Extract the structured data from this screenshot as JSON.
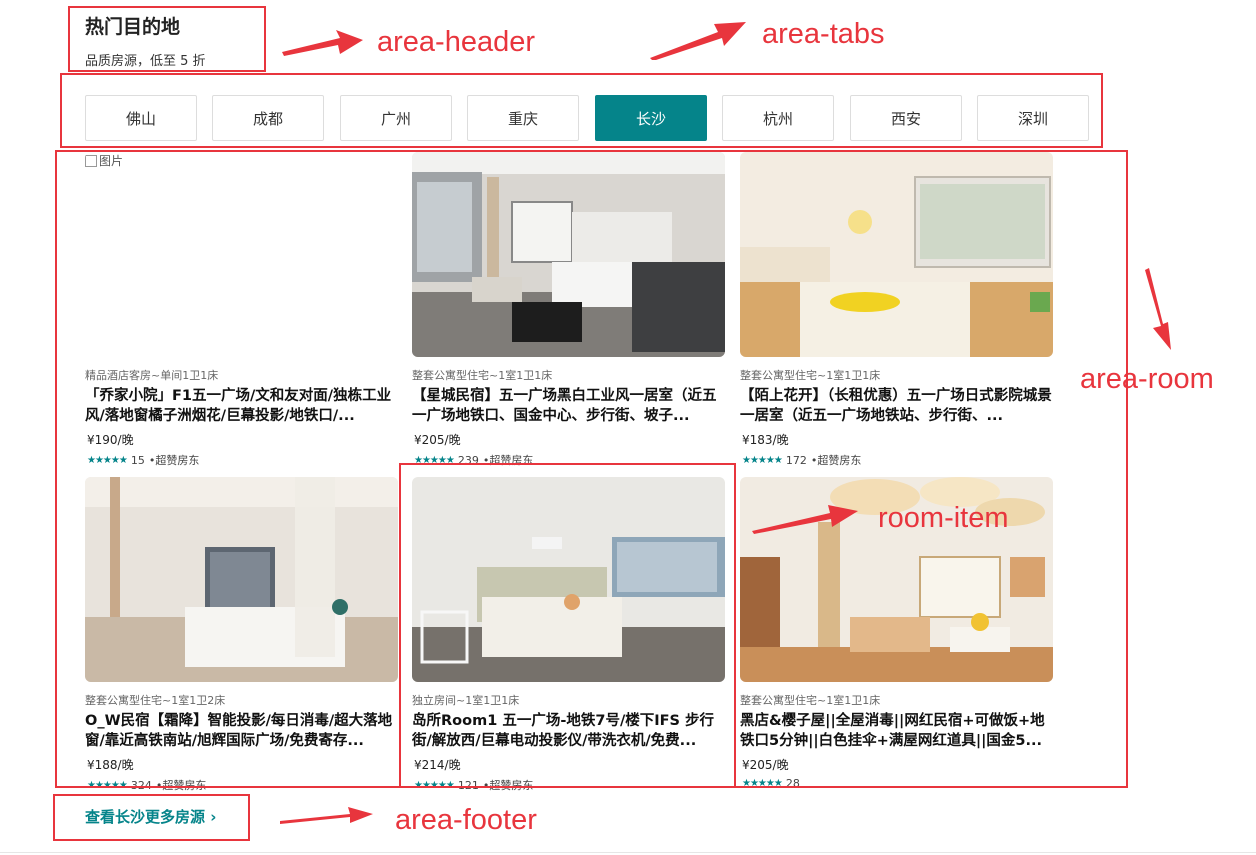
{
  "header": {
    "title": "热门目的地",
    "subtitle": "品质房源，低至 5 折"
  },
  "tabs": [
    {
      "label": "佛山"
    },
    {
      "label": "成都"
    },
    {
      "label": "广州"
    },
    {
      "label": "重庆"
    },
    {
      "label": "长沙",
      "active": true
    },
    {
      "label": "杭州"
    },
    {
      "label": "西安"
    },
    {
      "label": "深圳"
    }
  ],
  "rooms": [
    {
      "broken_alt": "图片",
      "type": "精品酒店客房~单间1卫1床",
      "title": "「乔家小院」F1五一广场/文和友对面/独栋工业风/落地窗橘子洲烟花/巨幕投影/地铁口/...",
      "price": "¥190/晚",
      "stars": "★★★★★",
      "reviews": "15",
      "badge": "•超赞房东"
    },
    {
      "type": "整套公寓型住宅~1室1卫1床",
      "title": "【星城民宿】五一广场黑白工业风一居室（近五一广场地铁口、国金中心、步行街、坡子...",
      "price": "¥205/晚",
      "stars": "★★★★★",
      "reviews": "239",
      "badge": "•超赞房东"
    },
    {
      "type": "整套公寓型住宅~1室1卫1床",
      "title": "【陌上花开】（长租优惠）五一广场日式影院城景一居室（近五一广场地铁站、步行街、...",
      "price": "¥183/晚",
      "stars": "★★★★★",
      "reviews": "172",
      "badge": "•超赞房东"
    },
    {
      "type": "整套公寓型住宅~1室1卫2床",
      "title": "O_W民宿【霜降】智能投影/每日消毒/超大落地窗/靠近高铁南站/旭辉国际广场/免费寄存...",
      "price": "¥188/晚",
      "stars": "★★★★★",
      "reviews": "324",
      "badge": "•超赞房东"
    },
    {
      "type": "独立房间~1室1卫1床",
      "title": "岛所Room1 五一广场-地铁7号/楼下IFS 步行街/解放西/巨幕电动投影仪/带洗衣机/免费...",
      "price": "¥214/晚",
      "stars": "★★★★★",
      "reviews": "121",
      "badge": "•超赞房东"
    },
    {
      "type": "整套公寓型住宅~1室1卫1床",
      "title": "黑店&樱子屋||全屋消毒||网红民宿+可做饭+地铁口5分钟||白色挂伞+满屋网红道具||国金5...",
      "price": "¥205/晚",
      "stars": "★★★★★",
      "reviews": "28",
      "badge": ""
    }
  ],
  "footer": {
    "more_link": "查看长沙更多房源 ›"
  },
  "annotations": {
    "header": "area-header",
    "tabs": "area-tabs",
    "room": "area-room",
    "room_item": "room-item",
    "footer": "area-footer"
  },
  "colors": {
    "accent": "#05848a",
    "annotation": "#e8353d"
  }
}
